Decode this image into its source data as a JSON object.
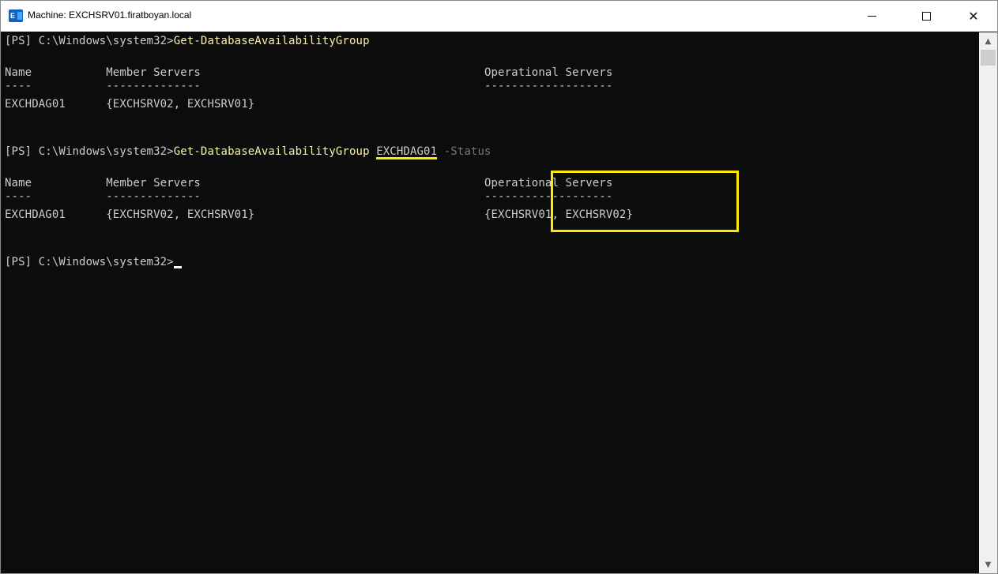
{
  "window": {
    "title": "Machine: EXCHSRV01.firatboyan.local",
    "icon": "exchange-management-shell-icon",
    "controls": {
      "minimize": "minimize-icon",
      "maximize": "maximize-icon",
      "close": "✕"
    }
  },
  "console": {
    "block1": {
      "prompt": "[PS] C:\\Windows\\system32>",
      "command": "Get-DatabaseAvailabilityGroup",
      "header_line": "Name           Member Servers                                          Operational Servers",
      "dash_line": "----           --------------                                          -------------------",
      "row_line": "EXCHDAG01      {EXCHSRV02, EXCHSRV01}"
    },
    "block2": {
      "prompt": "[PS] C:\\Windows\\system32>",
      "command": "Get-DatabaseAvailabilityGroup",
      "argument": "EXCHDAG01",
      "parameter": "-Status",
      "header_line": "Name           Member Servers                                          Operational Servers",
      "dash_line": "----           --------------                                          -------------------",
      "row_line": "EXCHDAG01      {EXCHSRV02, EXCHSRV01}                                  {EXCHSRV01, EXCHSRV02}"
    },
    "current_prompt": "[PS] C:\\Windows\\system32>"
  },
  "colors": {
    "background": "#0c0c0c",
    "text": "#cccccc",
    "command": "#f9f1a5",
    "parameter": "#767676",
    "highlight": "#ffe800"
  }
}
